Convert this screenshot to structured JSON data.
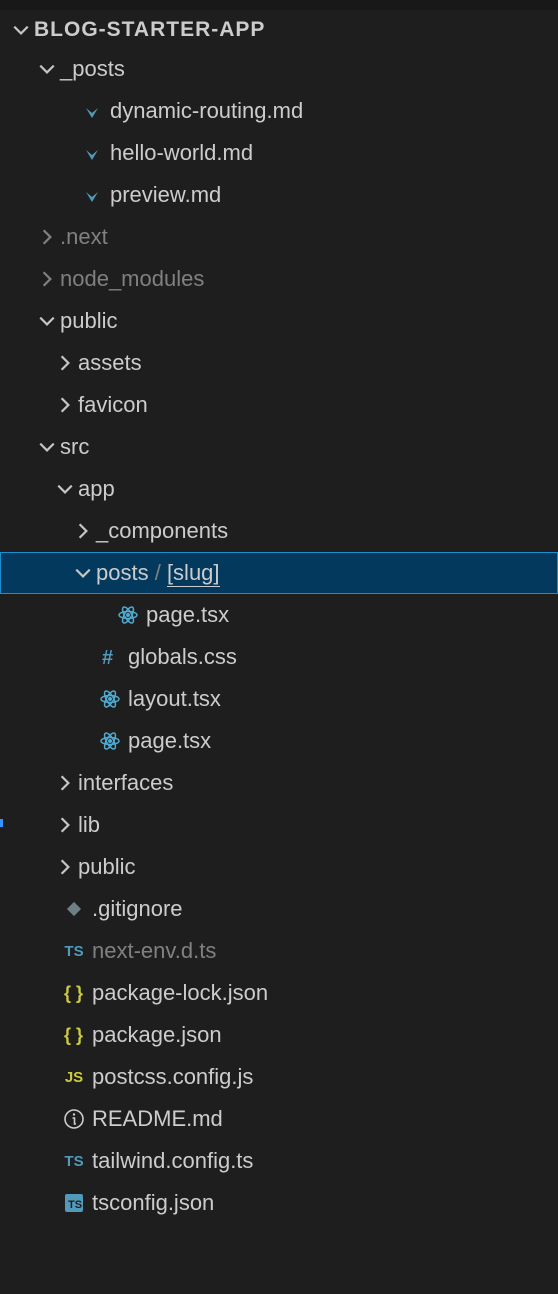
{
  "project": {
    "name": "BLOG-STARTER-APP"
  },
  "tree": {
    "posts": {
      "label": "_posts"
    },
    "posts_files": {
      "dynamic": "dynamic-routing.md",
      "hello": "hello-world.md",
      "preview": "preview.md"
    },
    "next": {
      "label": ".next"
    },
    "node_modules": {
      "label": "node_modules"
    },
    "public": {
      "label": "public"
    },
    "public_sub": {
      "assets": "assets",
      "favicon": "favicon"
    },
    "src": {
      "label": "src"
    },
    "app": {
      "label": "app"
    },
    "components": {
      "label": "_components"
    },
    "posts_folder": {
      "label": "posts",
      "sep": " / ",
      "slug": "[slug]"
    },
    "page_slug": {
      "label": "page.tsx"
    },
    "globals": {
      "label": "globals.css"
    },
    "layout": {
      "label": "layout.tsx"
    },
    "page_app": {
      "label": "page.tsx"
    },
    "interfaces": {
      "label": "interfaces"
    },
    "lib": {
      "label": "lib"
    },
    "src_public": {
      "label": "public"
    },
    "gitignore": {
      "label": ".gitignore"
    },
    "nextenv": {
      "label": "next-env.d.ts"
    },
    "pkglock": {
      "label": "package-lock.json"
    },
    "pkg": {
      "label": "package.json"
    },
    "postcss": {
      "label": "postcss.config.js"
    },
    "readme": {
      "label": "README.md"
    },
    "tailwind": {
      "label": "tailwind.config.ts"
    },
    "tsconfig": {
      "label": "tsconfig.json"
    }
  },
  "icons": {
    "ts_text": "TS",
    "js_text": "JS"
  }
}
